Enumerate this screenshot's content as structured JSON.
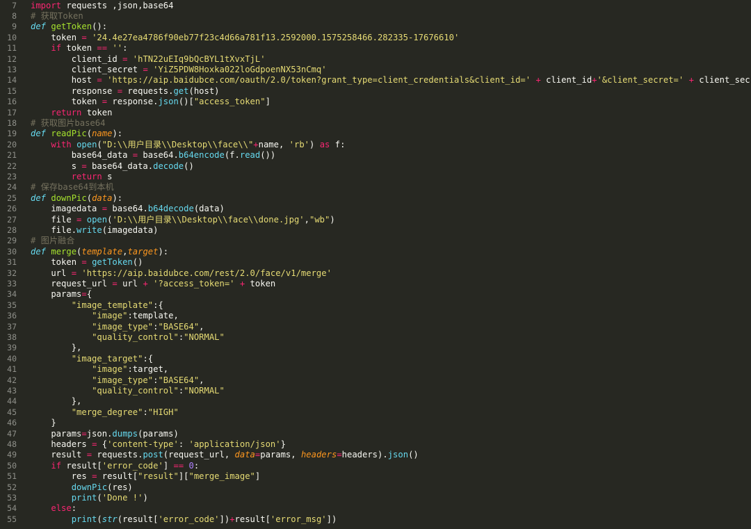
{
  "editor": {
    "first_line_number": 7,
    "lines": [
      {
        "n": "7",
        "tokens": [
          [
            "kw",
            "import"
          ],
          [
            "pl",
            " requests ,json,base64"
          ]
        ]
      },
      {
        "n": "8",
        "tokens": [
          [
            "cm",
            "# 获取Token"
          ]
        ]
      },
      {
        "n": "9",
        "tokens": [
          [
            "df",
            "def"
          ],
          [
            "pl",
            " "
          ],
          [
            "fn",
            "getToken"
          ],
          [
            "pl",
            "():"
          ]
        ]
      },
      {
        "n": "10",
        "tokens": [
          [
            "pl",
            "    token "
          ],
          [
            "op",
            "="
          ],
          [
            "pl",
            " "
          ],
          [
            "st",
            "'24.4e27ea4786f90eb77f23c4d66a781f13.2592000.1575258466.282335-17676610'"
          ]
        ]
      },
      {
        "n": "11",
        "tokens": [
          [
            "pl",
            "    "
          ],
          [
            "kw",
            "if"
          ],
          [
            "pl",
            " token "
          ],
          [
            "op",
            "=="
          ],
          [
            "pl",
            " "
          ],
          [
            "st",
            "''"
          ],
          [
            "pl",
            ":"
          ]
        ]
      },
      {
        "n": "12",
        "tokens": [
          [
            "pl",
            "        client_id "
          ],
          [
            "op",
            "="
          ],
          [
            "pl",
            " "
          ],
          [
            "st",
            "'hTN22uEIq9bQcBYL1tXvxTjL'"
          ]
        ]
      },
      {
        "n": "13",
        "tokens": [
          [
            "pl",
            "        client_secret "
          ],
          [
            "op",
            "="
          ],
          [
            "pl",
            " "
          ],
          [
            "st",
            "'YiZ5PDW8Hoxka022loGdpoenNX53nCmq'"
          ]
        ]
      },
      {
        "n": "14",
        "tokens": [
          [
            "pl",
            "        host "
          ],
          [
            "op",
            "="
          ],
          [
            "pl",
            " "
          ],
          [
            "st",
            "'https://aip.baidubce.com/oauth/2.0/token?grant_type=client_credentials&client_id='"
          ],
          [
            "pl",
            " "
          ],
          [
            "op",
            "+"
          ],
          [
            "pl",
            " client_id"
          ],
          [
            "op",
            "+"
          ],
          [
            "st",
            "'&client_secret='"
          ],
          [
            "pl",
            " "
          ],
          [
            "op",
            "+"
          ],
          [
            "pl",
            " client_secret"
          ]
        ]
      },
      {
        "n": "15",
        "tokens": [
          [
            "pl",
            "        response "
          ],
          [
            "op",
            "="
          ],
          [
            "pl",
            " requests."
          ],
          [
            "mt",
            "get"
          ],
          [
            "pl",
            "(host)"
          ]
        ]
      },
      {
        "n": "16",
        "tokens": [
          [
            "pl",
            "        token "
          ],
          [
            "op",
            "="
          ],
          [
            "pl",
            " response."
          ],
          [
            "mt",
            "json"
          ],
          [
            "pl",
            "()["
          ],
          [
            "st",
            "\"access_token\""
          ],
          [
            "pl",
            "]"
          ]
        ]
      },
      {
        "n": "17",
        "tokens": [
          [
            "pl",
            "    "
          ],
          [
            "kw",
            "return"
          ],
          [
            "pl",
            " token"
          ]
        ]
      },
      {
        "n": "18",
        "tokens": [
          [
            "cm",
            "# 获取图片base64"
          ]
        ]
      },
      {
        "n": "19",
        "tokens": [
          [
            "df",
            "def"
          ],
          [
            "pl",
            " "
          ],
          [
            "fn",
            "readPic"
          ],
          [
            "pl",
            "("
          ],
          [
            "pa",
            "name"
          ],
          [
            "pl",
            "):"
          ]
        ]
      },
      {
        "n": "20",
        "tokens": [
          [
            "pl",
            "    "
          ],
          [
            "kw",
            "with"
          ],
          [
            "pl",
            " "
          ],
          [
            "mt",
            "open"
          ],
          [
            "pl",
            "("
          ],
          [
            "st",
            "\"D:\\\\用户目录\\\\Desktop\\\\face\\\\\""
          ],
          [
            "op",
            "+"
          ],
          [
            "pl",
            "name, "
          ],
          [
            "st",
            "'rb'"
          ],
          [
            "pl",
            ") "
          ],
          [
            "kw",
            "as"
          ],
          [
            "pl",
            " f:"
          ]
        ]
      },
      {
        "n": "21",
        "tokens": [
          [
            "pl",
            "        base64_data "
          ],
          [
            "op",
            "="
          ],
          [
            "pl",
            " base64."
          ],
          [
            "mt",
            "b64encode"
          ],
          [
            "pl",
            "(f."
          ],
          [
            "mt",
            "read"
          ],
          [
            "pl",
            "())"
          ]
        ]
      },
      {
        "n": "22",
        "tokens": [
          [
            "pl",
            "        s "
          ],
          [
            "op",
            "="
          ],
          [
            "pl",
            " base64_data."
          ],
          [
            "mt",
            "decode"
          ],
          [
            "pl",
            "()"
          ]
        ]
      },
      {
        "n": "23",
        "tokens": [
          [
            "pl",
            "        "
          ],
          [
            "kw",
            "return"
          ],
          [
            "pl",
            " s"
          ]
        ]
      },
      {
        "n": "24",
        "tokens": [
          [
            "cm",
            "# 保存base64到本机"
          ]
        ]
      },
      {
        "n": "25",
        "tokens": [
          [
            "df",
            "def"
          ],
          [
            "pl",
            " "
          ],
          [
            "fn",
            "downPic"
          ],
          [
            "pl",
            "("
          ],
          [
            "pa",
            "data"
          ],
          [
            "pl",
            "):"
          ]
        ]
      },
      {
        "n": "26",
        "tokens": [
          [
            "pl",
            "    imagedata "
          ],
          [
            "op",
            "="
          ],
          [
            "pl",
            " base64."
          ],
          [
            "mt",
            "b64decode"
          ],
          [
            "pl",
            "(data)"
          ]
        ]
      },
      {
        "n": "27",
        "tokens": [
          [
            "pl",
            "    file "
          ],
          [
            "op",
            "="
          ],
          [
            "pl",
            " "
          ],
          [
            "mt",
            "open"
          ],
          [
            "pl",
            "("
          ],
          [
            "st",
            "'D:\\\\用户目录\\\\Desktop\\\\face\\\\done.jpg'"
          ],
          [
            "pl",
            ","
          ],
          [
            "st",
            "\"wb\""
          ],
          [
            "pl",
            ")"
          ]
        ]
      },
      {
        "n": "28",
        "tokens": [
          [
            "pl",
            "    file."
          ],
          [
            "mt",
            "write"
          ],
          [
            "pl",
            "(imagedata)"
          ]
        ]
      },
      {
        "n": "29",
        "tokens": [
          [
            "cm",
            "# 图片融合"
          ]
        ]
      },
      {
        "n": "30",
        "tokens": [
          [
            "df",
            "def"
          ],
          [
            "pl",
            " "
          ],
          [
            "fn",
            "merge"
          ],
          [
            "pl",
            "("
          ],
          [
            "pa",
            "template"
          ],
          [
            "pl",
            ","
          ],
          [
            "pa",
            "target"
          ],
          [
            "pl",
            "):"
          ]
        ]
      },
      {
        "n": "31",
        "tokens": [
          [
            "pl",
            "    token "
          ],
          [
            "op",
            "="
          ],
          [
            "pl",
            " "
          ],
          [
            "mt",
            "getToken"
          ],
          [
            "pl",
            "()"
          ]
        ]
      },
      {
        "n": "32",
        "tokens": [
          [
            "pl",
            "    url "
          ],
          [
            "op",
            "="
          ],
          [
            "pl",
            " "
          ],
          [
            "st",
            "'https://aip.baidubce.com/rest/2.0/face/v1/merge'"
          ]
        ]
      },
      {
        "n": "33",
        "tokens": [
          [
            "pl",
            "    request_url "
          ],
          [
            "op",
            "="
          ],
          [
            "pl",
            " url "
          ],
          [
            "op",
            "+"
          ],
          [
            "pl",
            " "
          ],
          [
            "st",
            "'?access_token='"
          ],
          [
            "pl",
            " "
          ],
          [
            "op",
            "+"
          ],
          [
            "pl",
            " token"
          ]
        ]
      },
      {
        "n": "34",
        "tokens": [
          [
            "pl",
            "    params"
          ],
          [
            "op",
            "="
          ],
          [
            "pl",
            "{"
          ]
        ]
      },
      {
        "n": "35",
        "tokens": [
          [
            "pl",
            "        "
          ],
          [
            "st",
            "\"image_template\""
          ],
          [
            "pl",
            ":{"
          ]
        ]
      },
      {
        "n": "36",
        "tokens": [
          [
            "pl",
            "            "
          ],
          [
            "st",
            "\"image\""
          ],
          [
            "pl",
            ":template,"
          ]
        ]
      },
      {
        "n": "37",
        "tokens": [
          [
            "pl",
            "            "
          ],
          [
            "st",
            "\"image_type\""
          ],
          [
            "pl",
            ":"
          ],
          [
            "st",
            "\"BASE64\""
          ],
          [
            "pl",
            ","
          ]
        ]
      },
      {
        "n": "38",
        "tokens": [
          [
            "pl",
            "            "
          ],
          [
            "st",
            "\"quality_control\""
          ],
          [
            "pl",
            ":"
          ],
          [
            "st",
            "\"NORMAL\""
          ]
        ]
      },
      {
        "n": "39",
        "tokens": [
          [
            "pl",
            "        },"
          ]
        ]
      },
      {
        "n": "40",
        "tokens": [
          [
            "pl",
            "        "
          ],
          [
            "st",
            "\"image_target\""
          ],
          [
            "pl",
            ":{"
          ]
        ]
      },
      {
        "n": "41",
        "tokens": [
          [
            "pl",
            "            "
          ],
          [
            "st",
            "\"image\""
          ],
          [
            "pl",
            ":target,"
          ]
        ]
      },
      {
        "n": "42",
        "tokens": [
          [
            "pl",
            "            "
          ],
          [
            "st",
            "\"image_type\""
          ],
          [
            "pl",
            ":"
          ],
          [
            "st",
            "\"BASE64\""
          ],
          [
            "pl",
            ","
          ]
        ]
      },
      {
        "n": "43",
        "tokens": [
          [
            "pl",
            "            "
          ],
          [
            "st",
            "\"quality_control\""
          ],
          [
            "pl",
            ":"
          ],
          [
            "st",
            "\"NORMAL\""
          ]
        ]
      },
      {
        "n": "44",
        "tokens": [
          [
            "pl",
            "        },"
          ]
        ]
      },
      {
        "n": "45",
        "tokens": [
          [
            "pl",
            "        "
          ],
          [
            "st",
            "\"merge_degree\""
          ],
          [
            "pl",
            ":"
          ],
          [
            "st",
            "\"HIGH\""
          ]
        ]
      },
      {
        "n": "46",
        "tokens": [
          [
            "pl",
            "    }"
          ]
        ]
      },
      {
        "n": "47",
        "tokens": [
          [
            "pl",
            "    params"
          ],
          [
            "op",
            "="
          ],
          [
            "pl",
            "json."
          ],
          [
            "mt",
            "dumps"
          ],
          [
            "pl",
            "(params)"
          ]
        ]
      },
      {
        "n": "48",
        "tokens": [
          [
            "pl",
            "    headers "
          ],
          [
            "op",
            "="
          ],
          [
            "pl",
            " {"
          ],
          [
            "st",
            "'content-type'"
          ],
          [
            "pl",
            ": "
          ],
          [
            "st",
            "'application/json'"
          ],
          [
            "pl",
            "}"
          ]
        ]
      },
      {
        "n": "49",
        "tokens": [
          [
            "pl",
            "    result "
          ],
          [
            "op",
            "="
          ],
          [
            "pl",
            " requests."
          ],
          [
            "mt",
            "post"
          ],
          [
            "pl",
            "(request_url, "
          ],
          [
            "pa",
            "data"
          ],
          [
            "op",
            "="
          ],
          [
            "pl",
            "params, "
          ],
          [
            "pa",
            "headers"
          ],
          [
            "op",
            "="
          ],
          [
            "pl",
            "headers)."
          ],
          [
            "mt",
            "json"
          ],
          [
            "pl",
            "()"
          ]
        ]
      },
      {
        "n": "50",
        "tokens": [
          [
            "pl",
            "    "
          ],
          [
            "kw",
            "if"
          ],
          [
            "pl",
            " result["
          ],
          [
            "st",
            "'error_code'"
          ],
          [
            "pl",
            "] "
          ],
          [
            "op",
            "=="
          ],
          [
            "pl",
            " "
          ],
          [
            "nu",
            "0"
          ],
          [
            "pl",
            ":"
          ]
        ]
      },
      {
        "n": "51",
        "tokens": [
          [
            "pl",
            "        res "
          ],
          [
            "op",
            "="
          ],
          [
            "pl",
            " result["
          ],
          [
            "st",
            "\"result\""
          ],
          [
            "pl",
            "]["
          ],
          [
            "st",
            "\"merge_image\""
          ],
          [
            "pl",
            "]"
          ]
        ]
      },
      {
        "n": "52",
        "tokens": [
          [
            "pl",
            "        "
          ],
          [
            "mt",
            "downPic"
          ],
          [
            "pl",
            "(res)"
          ]
        ]
      },
      {
        "n": "53",
        "tokens": [
          [
            "pl",
            "        "
          ],
          [
            "mt",
            "print"
          ],
          [
            "pl",
            "("
          ],
          [
            "st",
            "'Done !'"
          ],
          [
            "pl",
            ")"
          ]
        ]
      },
      {
        "n": "54",
        "tokens": [
          [
            "pl",
            "    "
          ],
          [
            "kw",
            "else"
          ],
          [
            "pl",
            ":"
          ]
        ]
      },
      {
        "n": "55",
        "tokens": [
          [
            "pl",
            "        "
          ],
          [
            "mt",
            "print"
          ],
          [
            "pl",
            "("
          ],
          [
            "bi",
            "str"
          ],
          [
            "pl",
            "(result["
          ],
          [
            "st",
            "'error_code'"
          ],
          [
            "pl",
            "])"
          ],
          [
            "op",
            "+"
          ],
          [
            "pl",
            "result["
          ],
          [
            "st",
            "'error_msg'"
          ],
          [
            "pl",
            "])"
          ]
        ]
      }
    ]
  },
  "colors": {
    "background": "#272822",
    "line_number": "#8f908a",
    "keyword": "#f92672",
    "function_name": "#a6e22e",
    "string": "#e6db74",
    "comment": "#75715e",
    "builtin": "#66d9ef",
    "parameter": "#fd971f",
    "number": "#ae81ff",
    "plain": "#f8f8f2"
  }
}
